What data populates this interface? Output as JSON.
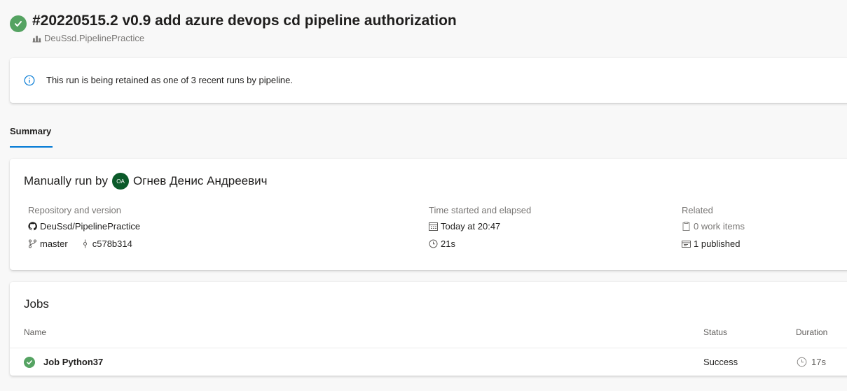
{
  "run": {
    "title": "#20220515.2 v0.9 add azure devops cd pipeline authorization",
    "pipeline_name": "DeuSsd.PipelinePractice"
  },
  "banner": {
    "text": "This run is being retained as one of 3 recent runs by pipeline."
  },
  "tabs": [
    {
      "label": "Summary",
      "active": true
    }
  ],
  "summary": {
    "manual_prefix": "Manually run by",
    "avatar_initials": "OA",
    "user_name": "Огнев Денис Андреевич",
    "repo": {
      "label": "Repository and version",
      "name": "DeuSsd/PipelinePractice",
      "branch": "master",
      "commit": "c578b314"
    },
    "time": {
      "label": "Time started and elapsed",
      "started": "Today at 20:47",
      "elapsed": "21s"
    },
    "related": {
      "label": "Related",
      "work_items": "0 work items",
      "published": "1 published"
    }
  },
  "jobs": {
    "title": "Jobs",
    "columns": {
      "name": "Name",
      "status": "Status",
      "duration": "Duration"
    },
    "rows": [
      {
        "name": "Job Python37",
        "status": "Success",
        "duration": "17s"
      }
    ]
  },
  "colors": {
    "success": "#55a362",
    "accent": "#0078d4",
    "avatar": "#0b5a2a"
  },
  "icons": {
    "status": "success-check-icon",
    "pipeline": "pipeline-icon",
    "info": "info-icon",
    "repo": "github-icon",
    "branch": "branch-icon",
    "commit": "commit-icon",
    "calendar": "calendar-icon",
    "clock": "clock-icon",
    "work_items": "work-item-icon",
    "artifact": "artifact-icon"
  }
}
